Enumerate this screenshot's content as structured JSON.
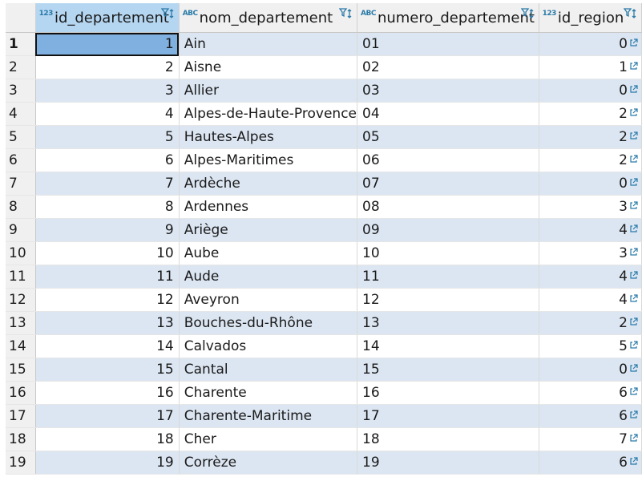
{
  "columns": [
    {
      "key": "id_departement",
      "label": "id_departement",
      "type_badge": "123"
    },
    {
      "key": "nom_departement",
      "label": "nom_departement",
      "type_badge": "ABC"
    },
    {
      "key": "numero_departement",
      "label": "numero_departement",
      "type_badge": "ABC"
    },
    {
      "key": "id_region",
      "label": "id_region",
      "type_badge": "123"
    }
  ],
  "rows": [
    {
      "row": "1",
      "id": "1",
      "nom": "Ain",
      "num": "01",
      "region": "0"
    },
    {
      "row": "2",
      "id": "2",
      "nom": "Aisne",
      "num": "02",
      "region": "1"
    },
    {
      "row": "3",
      "id": "3",
      "nom": "Allier",
      "num": "03",
      "region": "0"
    },
    {
      "row": "4",
      "id": "4",
      "nom": "Alpes-de-Haute-Provence",
      "num": "04",
      "region": "2"
    },
    {
      "row": "5",
      "id": "5",
      "nom": "Hautes-Alpes",
      "num": "05",
      "region": "2"
    },
    {
      "row": "6",
      "id": "6",
      "nom": "Alpes-Maritimes",
      "num": "06",
      "region": "2"
    },
    {
      "row": "7",
      "id": "7",
      "nom": "Ardèche",
      "num": "07",
      "region": "0"
    },
    {
      "row": "8",
      "id": "8",
      "nom": "Ardennes",
      "num": "08",
      "region": "3"
    },
    {
      "row": "9",
      "id": "9",
      "nom": "Ariège",
      "num": "09",
      "region": "4"
    },
    {
      "row": "10",
      "id": "10",
      "nom": "Aube",
      "num": "10",
      "region": "3"
    },
    {
      "row": "11",
      "id": "11",
      "nom": "Aude",
      "num": "11",
      "region": "4"
    },
    {
      "row": "12",
      "id": "12",
      "nom": "Aveyron",
      "num": "12",
      "region": "4"
    },
    {
      "row": "13",
      "id": "13",
      "nom": "Bouches-du-Rhône",
      "num": "13",
      "region": "2"
    },
    {
      "row": "14",
      "id": "14",
      "nom": "Calvados",
      "num": "14",
      "region": "5"
    },
    {
      "row": "15",
      "id": "15",
      "nom": "Cantal",
      "num": "15",
      "region": "0"
    },
    {
      "row": "16",
      "id": "16",
      "nom": "Charente",
      "num": "16",
      "region": "6"
    },
    {
      "row": "17",
      "id": "17",
      "nom": "Charente-Maritime",
      "num": "17",
      "region": "6"
    },
    {
      "row": "18",
      "id": "18",
      "nom": "Cher",
      "num": "18",
      "region": "7"
    },
    {
      "row": "19",
      "id": "19",
      "nom": "Corrèze",
      "num": "19",
      "region": "6"
    }
  ],
  "selection": {
    "row": "1",
    "column": "id_departement"
  },
  "colors": {
    "row_alt": "#dce6f2",
    "header_selected": "#b5d6f1",
    "cell_selected": "#7fb0e0",
    "badge": "#2a7aa8"
  }
}
